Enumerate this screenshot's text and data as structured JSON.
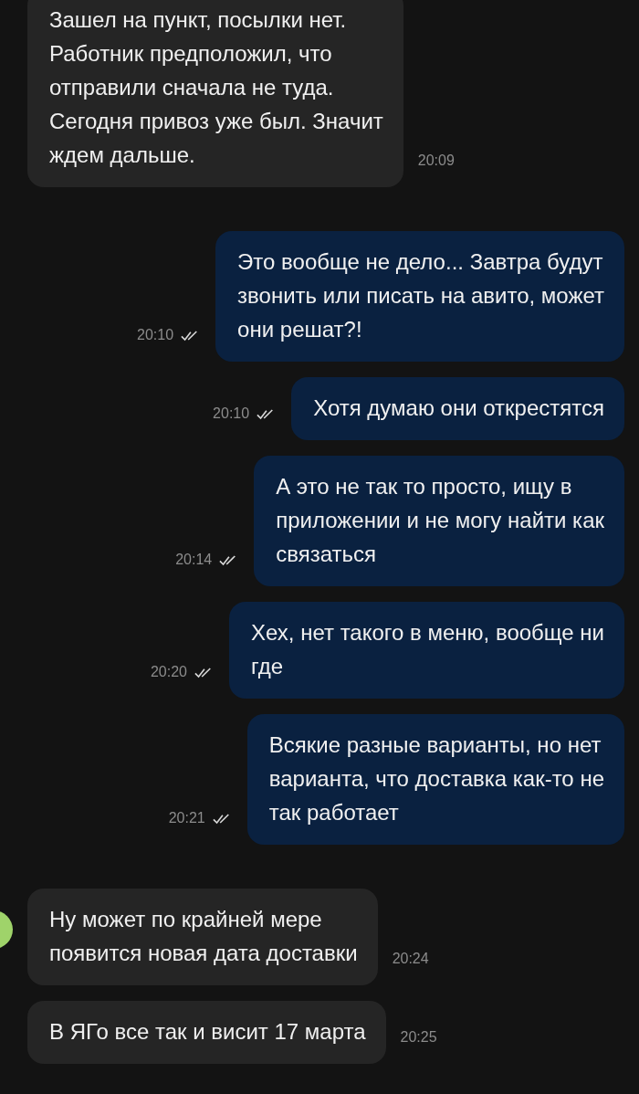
{
  "messages": [
    {
      "kind": "incoming",
      "text": "Зашел на пункт, посылки нет.\nРаботник предположил, что\nотправили сначала не туда.\nСегодня привоз уже был. Значит\nждем дальше.",
      "time": "20:09",
      "avatar": false
    },
    {
      "kind": "outgoing",
      "text": "Это вообще не дело... Завтра будут\nзвонить или писать на авито, может\nони решат?!",
      "time": "20:10",
      "read": true
    },
    {
      "kind": "outgoing",
      "text": "Хотя думаю они открестятся",
      "time": "20:10",
      "read": true
    },
    {
      "kind": "outgoing",
      "text": "А это не так то просто, ищу в\nприложении и не могу найти как\nсвязаться",
      "time": "20:14",
      "read": true
    },
    {
      "kind": "outgoing",
      "text": "Хех, нет такого в меню, вообще ни\nгде",
      "time": "20:20",
      "read": true
    },
    {
      "kind": "outgoing",
      "text": "Всякие разные варианты, но нет\nварианта, что доставка как-то не\nтак работает",
      "time": "20:21",
      "read": true
    },
    {
      "kind": "incoming",
      "text": "Ну может по крайней мере\nпоявится новая дата доставки",
      "time": "20:24",
      "avatar": true
    },
    {
      "kind": "incoming",
      "text": "В ЯГо все так и висит 17 марта",
      "time": "20:25",
      "avatar": false
    }
  ]
}
